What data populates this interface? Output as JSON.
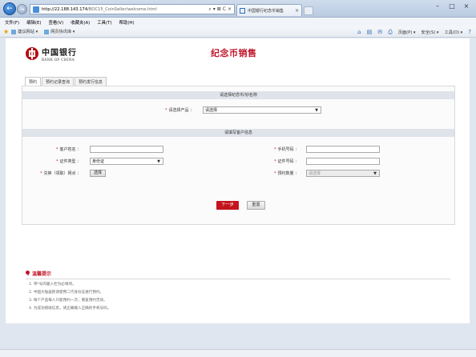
{
  "browser": {
    "url_host": "http://22.188.143.174",
    "url_path": "/BOC15_CoinSeller/welcome.html",
    "addr_tools": [
      "⌕",
      "▾",
      "⊠",
      "C",
      "×"
    ],
    "tab_title": "中国银行纪念币销售",
    "tab_close": "×",
    "window_controls": [
      "–",
      "□",
      "×"
    ],
    "menu": [
      "文件(F)",
      "编辑(E)",
      "查看(V)",
      "收藏夹(A)",
      "工具(T)",
      "帮助(H)"
    ],
    "favorites": [
      {
        "label": "建议网站 ▾"
      },
      {
        "label": "网页快讯库 ▾"
      }
    ],
    "commands": [
      "页面(P) ▾",
      "安全(S) ▾",
      "工具(O) ▾"
    ],
    "colors": {
      "accent": "#1f5fb6"
    }
  },
  "page": {
    "logo_cn": "中国银行",
    "logo_en": "BANK OF CHINA",
    "title": "纪念币销售",
    "tabs": [
      "预约",
      "预约记录查询",
      "预约发行信息"
    ],
    "section1": {
      "heading": "请选择纪念币/钞名称",
      "product_label": "请选择产品",
      "product_value": "请选择"
    },
    "section2": {
      "heading": "请填写客户信息",
      "name_label": "客户姓名",
      "id_type_label": "证件类型",
      "id_type_value": "身份证",
      "branch_label": "兑换（领取）网点",
      "branch_button": "选择",
      "phone_label": "手机号码",
      "id_no_label": "证件号码",
      "quantity_label": "预约数量",
      "quantity_value": "请选择"
    },
    "buttons": {
      "next": "下一步",
      "reset": "重置"
    },
    "tips": {
      "title": "温馨提示",
      "items": [
        "1. 带*号的输入栏为必填项。",
        "2. 中国大陆居民请使用二代身份证进行预约。",
        "3. 每个产品每人只能预约一次，重复预约无效。",
        "4. 为成功接收信息，请正确输入正确的手机号码。"
      ]
    },
    "colors": {
      "brand_red": "#c0152a"
    }
  }
}
